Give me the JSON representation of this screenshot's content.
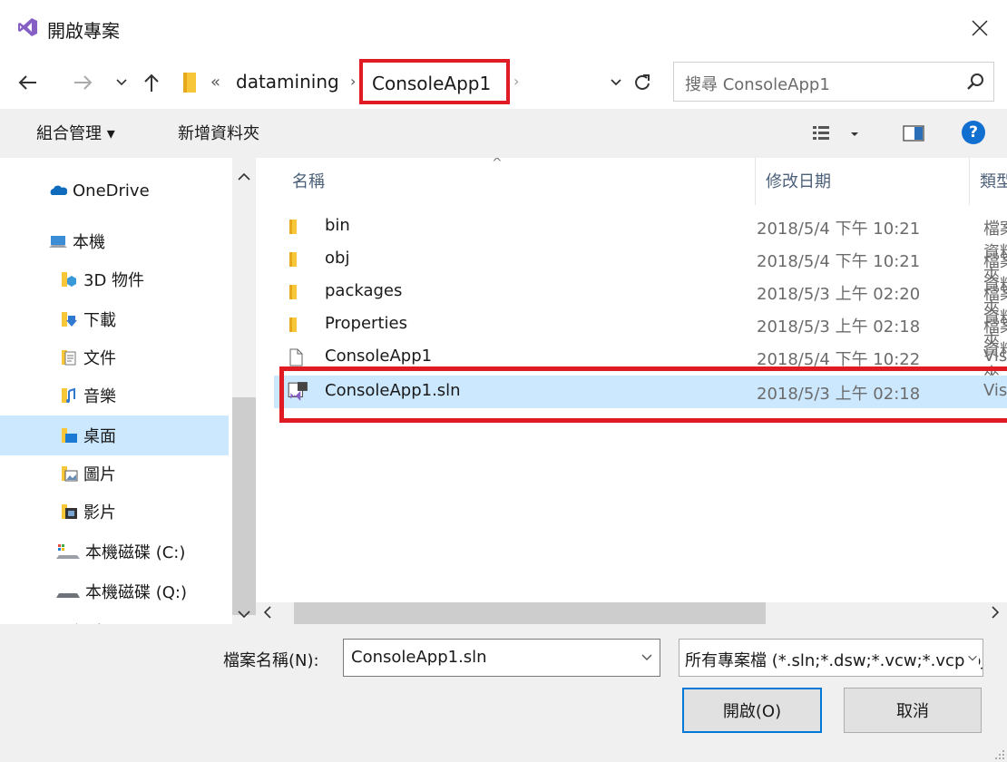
{
  "window": {
    "title": "開啟專案"
  },
  "address": {
    "overflow": "«",
    "path": [
      "datamining",
      "ConsoleApp1"
    ]
  },
  "search": {
    "placeholder": "搜尋 ConsoleApp1"
  },
  "toolbar": {
    "organize": "組合管理 ▾",
    "new_folder": "新增資料夾"
  },
  "sidebar": {
    "items": [
      {
        "label": "OneDrive",
        "icon": "onedrive-icon"
      },
      {
        "label": "本機",
        "icon": "computer-icon"
      },
      {
        "label": "3D 物件",
        "icon": "3d-objects-icon"
      },
      {
        "label": "下載",
        "icon": "downloads-icon"
      },
      {
        "label": "文件",
        "icon": "documents-icon"
      },
      {
        "label": "音樂",
        "icon": "music-icon"
      },
      {
        "label": "桌面",
        "icon": "desktop-icon",
        "selected": true
      },
      {
        "label": "圖片",
        "icon": "pictures-icon"
      },
      {
        "label": "影片",
        "icon": "videos-icon"
      },
      {
        "label": "本機磁碟 (C:)",
        "icon": "drive-c-icon"
      },
      {
        "label": "本機磁碟 (Q:)",
        "icon": "drive-q-icon"
      },
      {
        "label": "網路",
        "icon": "network-icon"
      }
    ]
  },
  "columns": {
    "name": "名稱",
    "date": "修改日期",
    "type": "類型"
  },
  "files": [
    {
      "name": "bin",
      "date": "2018/5/4 下午 10:21",
      "type": "檔案資料夾",
      "icon": "folder-icon"
    },
    {
      "name": "obj",
      "date": "2018/5/4 下午 10:21",
      "type": "檔案資料夾",
      "icon": "folder-icon"
    },
    {
      "name": "packages",
      "date": "2018/5/3 上午 02:20",
      "type": "檔案資料夾",
      "icon": "folder-icon"
    },
    {
      "name": "Properties",
      "date": "2018/5/3 上午 02:18",
      "type": "檔案資料夾",
      "icon": "folder-icon"
    },
    {
      "name": "ConsoleApp1",
      "date": "2018/5/4 下午 10:22",
      "type": "Visual",
      "icon": "file-icon"
    },
    {
      "name": "ConsoleApp1.sln",
      "date": "2018/5/3 上午 02:18",
      "type": "Visual",
      "icon": "vs-solution-icon",
      "selected": true
    }
  ],
  "bottom": {
    "filename_label": "檔案名稱(N):",
    "filename_value": "ConsoleApp1.sln",
    "filetype_value": "所有專案檔 (*.sln;*.dsw;*.vcw;*.vcproj)",
    "open_label": "開啟(O)",
    "cancel_label": "取消"
  },
  "colors": {
    "accent": "#0078d7",
    "selection": "#cce8ff",
    "highlight": "#e01b24",
    "folder": "#f8c639"
  }
}
